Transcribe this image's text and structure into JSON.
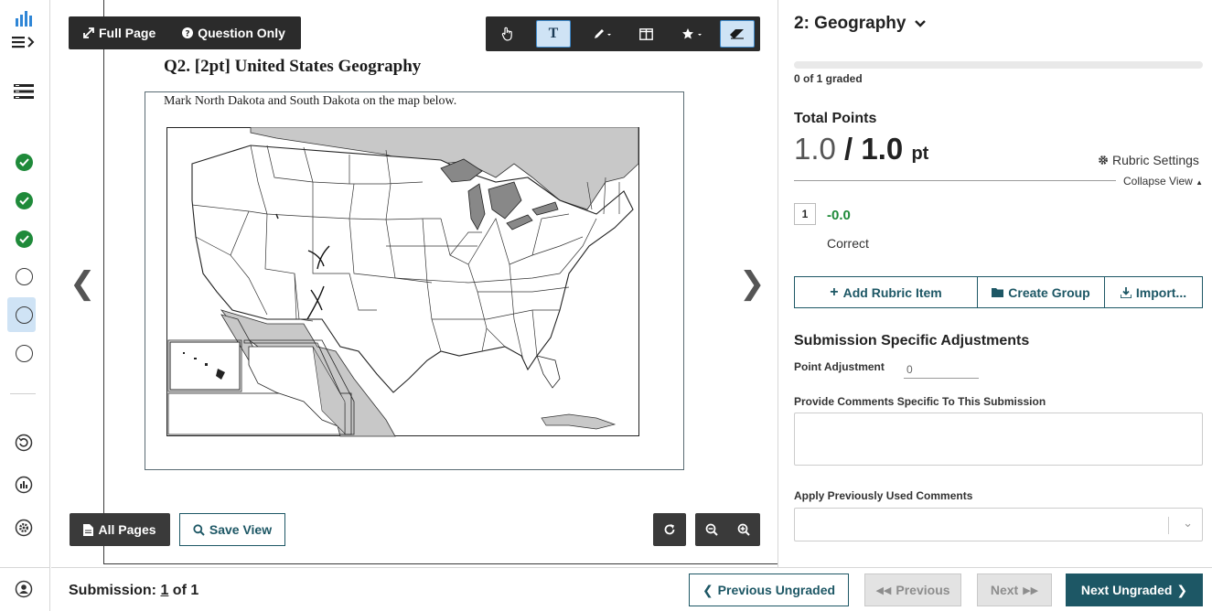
{
  "view_toggle": {
    "full_page": "Full Page",
    "question_only": "Question Only"
  },
  "tools": [
    "pointer-tool",
    "text-tool",
    "pen-tool",
    "split-tool",
    "star-tool",
    "eraser-tool"
  ],
  "question": {
    "title": "Q2.  [2pt] United States Geography",
    "instruction": "Mark North Dakota and South Dakota on the map below."
  },
  "viewer_buttons": {
    "all_pages": "All Pages",
    "save_view": "Save View"
  },
  "panel": {
    "question_select": "2: Geography",
    "graded_status": "0 of 1 graded",
    "progress": 0.0,
    "total_points_label": "Total Points",
    "score": "1.0",
    "score_max": "1.0",
    "score_unit": "pt",
    "rubric_settings": "Rubric Settings",
    "collapse_view": "Collapse View",
    "rubric_items": [
      {
        "number": "1",
        "points": "-0.0",
        "description": "Correct"
      }
    ],
    "add_rubric_item": "Add Rubric Item",
    "create_group": "Create Group",
    "import": "Import...",
    "ssa_title": "Submission Specific Adjustments",
    "point_adjustment_label": "Point Adjustment",
    "point_adjustment_value": "0",
    "comments_label": "Provide Comments Specific To This Submission",
    "apply_comments_label": "Apply Previously Used Comments"
  },
  "bottom": {
    "submission_prefix": "Submission: ",
    "submission_current": "1",
    "submission_suffix": " of 1",
    "previous_ungraded": "Previous Ungraded",
    "previous": "Previous",
    "next": "Next",
    "next_ungraded": "Next Ungraded"
  },
  "sidebar_status": [
    "graded",
    "graded",
    "graded",
    "ungraded",
    "current",
    "ungraded"
  ],
  "colors": {
    "accent": "#1d5765",
    "success": "#1f8a3a",
    "highlight": "#cfe3f5"
  }
}
